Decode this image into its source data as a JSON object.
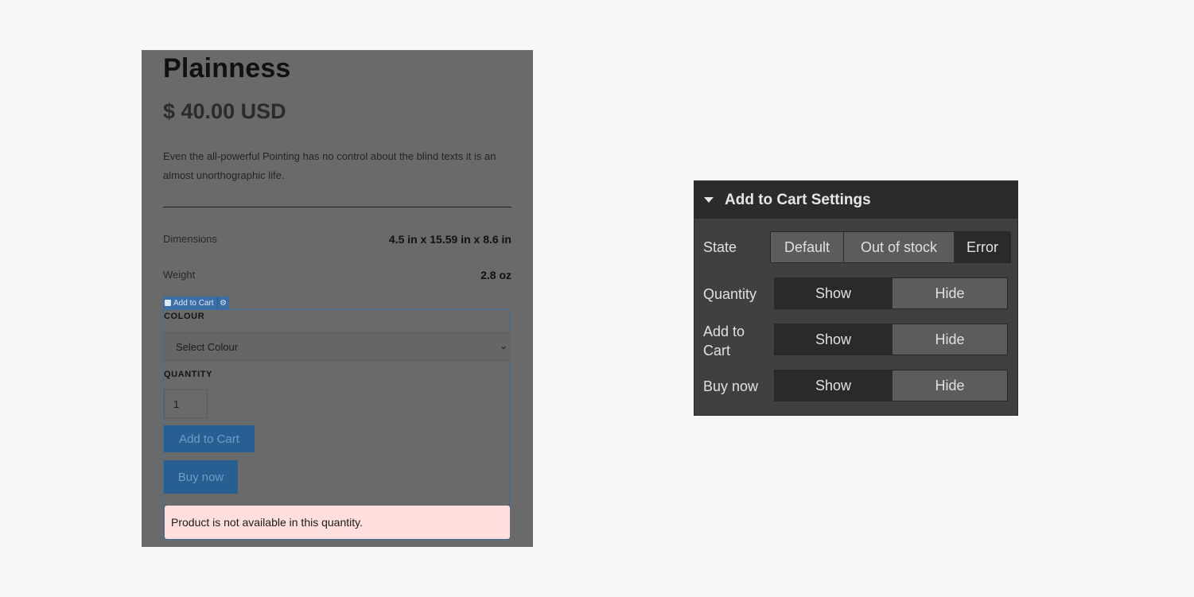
{
  "product": {
    "title": "Plainness",
    "price": "$ 40.00 USD",
    "description": "Even the all-powerful Pointing has no control about the blind texts it is an almost unorthographic life.",
    "specs": [
      {
        "label": "Dimensions",
        "value": "4.5 in x 15.59 in x 8.6 in"
      },
      {
        "label": "Weight",
        "value": "2.8 oz"
      }
    ]
  },
  "cart_form": {
    "tag_label": "Add to Cart",
    "colour_label": "COLOUR",
    "colour_select": "Select Colour",
    "quantity_label": "QUANTITY",
    "quantity_value": "1",
    "add_to_cart": "Add to Cart",
    "buy_now": "Buy now",
    "error_message": "Product is not available in this quantity."
  },
  "settings_panel": {
    "title": "Add to Cart Settings",
    "state": {
      "label": "State",
      "options": [
        "Default",
        "Out of stock",
        "Error"
      ],
      "selected": "Error"
    },
    "quantity": {
      "label": "Quantity",
      "show": "Show",
      "hide": "Hide",
      "selected": "Show"
    },
    "add_to_cart": {
      "label_line1": "Add to",
      "label_line2": "Cart",
      "show": "Show",
      "hide": "Hide",
      "selected": "Show"
    },
    "buy_now": {
      "label": "Buy now",
      "show": "Show",
      "hide": "Hide",
      "selected": "Show"
    }
  },
  "colors": {
    "page_bg": "#f6f7f9",
    "preview_overlay": "#6a6a6a",
    "panel_bg": "#404040",
    "panel_header": "#2b2b2b",
    "selection_blue": "#3a6ea5",
    "error_bg": "#ffdede"
  }
}
